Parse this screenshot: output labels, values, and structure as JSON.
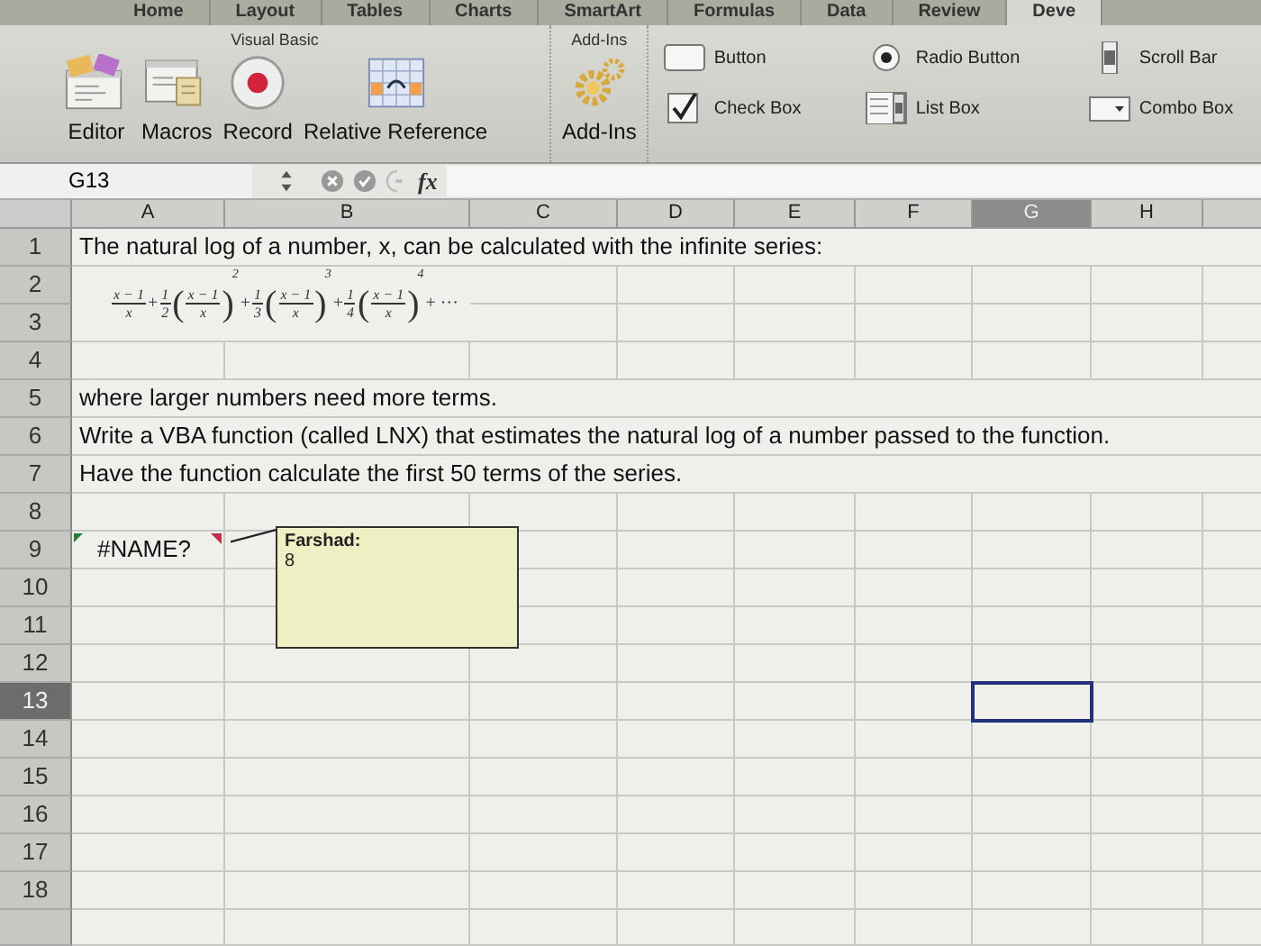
{
  "ribbon_tabs": [
    {
      "label": "Home",
      "selected": false
    },
    {
      "label": "Layout",
      "selected": false
    },
    {
      "label": "Tables",
      "selected": false
    },
    {
      "label": "Charts",
      "selected": false
    },
    {
      "label": "SmartArt",
      "selected": false
    },
    {
      "label": "Formulas",
      "selected": false
    },
    {
      "label": "Data",
      "selected": false
    },
    {
      "label": "Review",
      "selected": false
    },
    {
      "label": "Deve",
      "selected": true
    }
  ],
  "ribbon_groups": [
    {
      "title": "Visual Basic",
      "kind": "vb",
      "buttons": [
        {
          "label": "Editor",
          "kind": "editor"
        },
        {
          "label": "Macros",
          "kind": "macros"
        },
        {
          "label": "Record",
          "kind": "record"
        },
        {
          "label": "Relative Reference",
          "kind": "relative"
        }
      ]
    },
    {
      "title": "Add-Ins",
      "kind": "vb",
      "buttons": [
        {
          "label": "Add-Ins",
          "kind": "addins"
        }
      ]
    },
    {
      "kind": "controls",
      "buttons": [
        {
          "label": "Button",
          "kind": "button"
        },
        {
          "label": "Radio Button",
          "kind": "radio"
        },
        {
          "label": "Scroll Bar",
          "kind": "scrollbar"
        },
        {
          "label": "Check Box",
          "kind": "checkbox"
        },
        {
          "label": "List Box",
          "kind": "listbox"
        },
        {
          "label": "Combo Box",
          "kind": "combobox"
        }
      ]
    }
  ],
  "formula_bar": {
    "name_box": "G13",
    "function_label": "fx"
  },
  "columns": [
    {
      "label": "A",
      "selected": false
    },
    {
      "label": "B",
      "selected": false
    },
    {
      "label": "C",
      "selected": false
    },
    {
      "label": "D",
      "selected": false
    },
    {
      "label": "E",
      "selected": false
    },
    {
      "label": "F",
      "selected": false
    },
    {
      "label": "G",
      "selected": true
    },
    {
      "label": "H",
      "selected": false
    }
  ],
  "rows": [
    {
      "label": "1",
      "selected": false,
      "cell": {
        "text": "The natural log of a number, x, can be calculated with the infinite series:"
      }
    },
    {
      "label": "2",
      "selected": false
    },
    {
      "label": "3",
      "selected": false
    },
    {
      "label": "4",
      "selected": false
    },
    {
      "label": "5",
      "selected": false,
      "cell": {
        "text": "where larger numbers need more terms."
      }
    },
    {
      "label": "6",
      "selected": false,
      "cell": {
        "text": "Write a VBA function (called LNX) that estimates the natural log of a number passed to the function."
      }
    },
    {
      "label": "7",
      "selected": false,
      "cell": {
        "text": "Have the function calculate the first 50 terms of the series."
      }
    },
    {
      "label": "8",
      "selected": false
    },
    {
      "label": "9",
      "selected": false,
      "cell": {
        "text": "#NAME?",
        "kind": "error"
      }
    },
    {
      "label": "10",
      "selected": false
    },
    {
      "label": "11",
      "selected": false
    },
    {
      "label": "12",
      "selected": false
    },
    {
      "label": "13",
      "selected": true
    },
    {
      "label": "14",
      "selected": false
    },
    {
      "label": "15",
      "selected": false
    },
    {
      "label": "16",
      "selected": false
    },
    {
      "label": "17",
      "selected": false
    },
    {
      "label": "18",
      "selected": false
    }
  ],
  "series_formula": {
    "first": {
      "numerator": "x − 1",
      "denominator": "x"
    },
    "terms": [
      {
        "operator": "+",
        "coef_num": "1",
        "coef_den": "2",
        "open": "(",
        "numerator": "x − 1",
        "denominator": "x",
        "close": ")",
        "power": "2"
      },
      {
        "operator": "+",
        "coef_num": "1",
        "coef_den": "3",
        "open": "(",
        "numerator": "x − 1",
        "denominator": "x",
        "close": ")",
        "power": "3"
      },
      {
        "operator": "+",
        "coef_num": "1",
        "coef_den": "4",
        "open": "(",
        "numerator": "x − 1",
        "denominator": "x",
        "close": ")",
        "power": "4"
      }
    ],
    "tail": "+ ···"
  },
  "comment": {
    "author": "Farshad:",
    "text": "8"
  }
}
